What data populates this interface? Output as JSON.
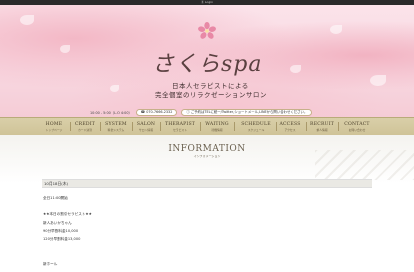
{
  "topbar": {
    "text": "Ⓢ Login"
  },
  "brand": {
    "logo_text": "さくらspa",
    "tagline1": "日本人セラピストによる",
    "tagline2": "完全個室のリラクゼーションサロン"
  },
  "infobar": {
    "hours": "10:00 - 5:00（L.O 4:00）",
    "phone": "070-7666-2332",
    "note": "ご予約はTELに統一/Twitter,ショートメール,LINEから問い合わせください。"
  },
  "nav": [
    {
      "en": "HOME",
      "jp": "トップページ"
    },
    {
      "en": "CREDIT",
      "jp": "カード決済"
    },
    {
      "en": "SYSTEM",
      "jp": "料金システム"
    },
    {
      "en": "SALON",
      "jp": "サロン情報"
    },
    {
      "en": "THERAPIST",
      "jp": "セラピスト"
    },
    {
      "en": "WAITING",
      "jp": "待機情報"
    },
    {
      "en": "SCHEDULE",
      "jp": "スケジュール"
    },
    {
      "en": "ACCESS",
      "jp": "アクセス"
    },
    {
      "en": "RECRUIT",
      "jp": "求人情報"
    },
    {
      "en": "CONTACT",
      "jp": "お問い合わせ"
    }
  ],
  "section": {
    "title": "INFORMATION",
    "subtitle": "インフォメーション"
  },
  "post": {
    "date": "10月18日(木)",
    "lines": [
      "全日11:00開始",
      "★★本日の割引セラピスト★★",
      "新人あいかちゃん",
      "90分早割料金10,000",
      "120分早割料金13,000",
      "新ホール"
    ]
  }
}
